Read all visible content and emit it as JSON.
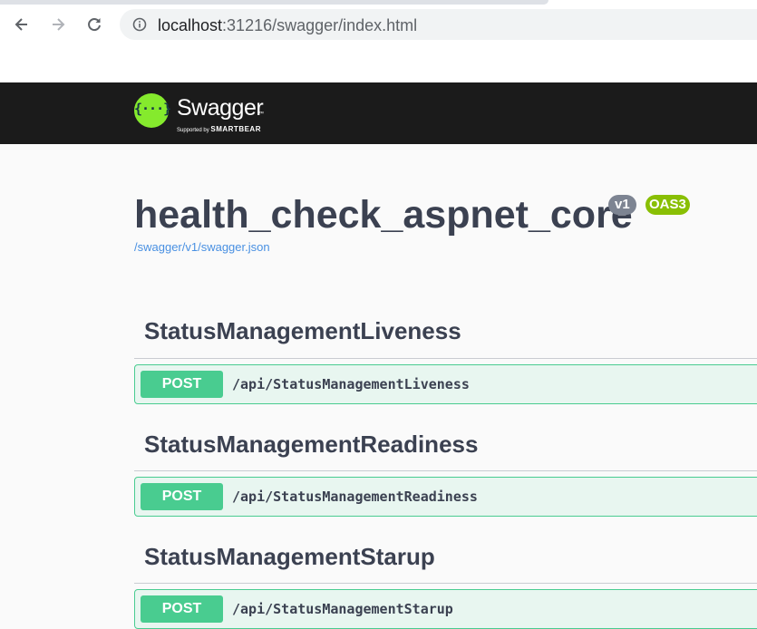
{
  "browser": {
    "url_host": "localhost",
    "url_rest": ":31216/swagger/index.html",
    "icons": [
      "back-icon",
      "forward-icon",
      "reload-icon",
      "info-icon"
    ]
  },
  "topbar": {
    "brand": "Swagger",
    "tm": "™",
    "supported_by": "Supported by",
    "company": "SMARTBEAR",
    "logo_glyph": "{···}"
  },
  "info": {
    "title": "health_check_aspnet_core",
    "version": "v1",
    "oas": "OAS3",
    "spec_link": "/swagger/v1/swagger.json"
  },
  "sections": [
    {
      "name": "StatusManagementLiveness",
      "method": "POST",
      "path": "/api/StatusManagementLiveness"
    },
    {
      "name": "StatusManagementReadiness",
      "method": "POST",
      "path": "/api/StatusManagementReadiness"
    },
    {
      "name": "StatusManagementStarup",
      "method": "POST",
      "path": "/api/StatusManagementStarup"
    }
  ],
  "colors": {
    "topbar": "#1b1b1b",
    "logo": "#85ea2d",
    "post": "#49cc90",
    "post_bg": "#e8f6f0",
    "version_badge": "#7d8492",
    "oas_badge": "#89bf04",
    "link": "#4990e2"
  }
}
